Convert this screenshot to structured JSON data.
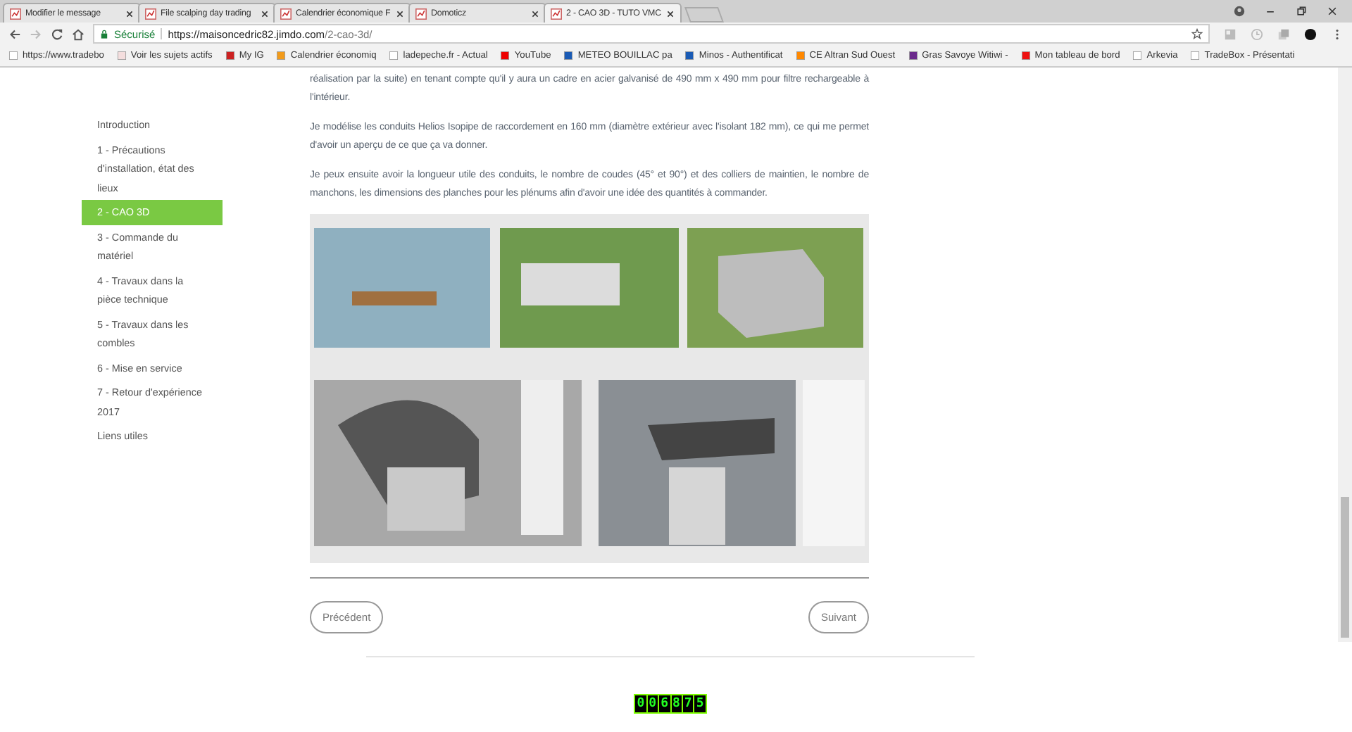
{
  "tabs": [
    {
      "title": "Modifier le message",
      "selected": false
    },
    {
      "title": "File scalping day trading",
      "selected": false
    },
    {
      "title": "Calendrier économique F",
      "selected": false
    },
    {
      "title": "Domoticz",
      "selected": false
    },
    {
      "title": "2 - CAO 3D - TUTO VMC",
      "selected": true
    }
  ],
  "address": {
    "secure_label": "Sécurisé",
    "host": "https://maisoncedric82.jimdo.com",
    "path": "/2-cao-3d/"
  },
  "bookmarks": [
    "https://www.tradebo",
    "Voir les sujets actifs",
    "My IG",
    "Calendrier économiq",
    "ladepeche.fr - Actual",
    "YouTube",
    "METEO BOUILLAC pa",
    "Minos - Authentificat",
    "CE Altran Sud Ouest",
    "Gras Savoye Witiwi -",
    "Mon tableau de bord",
    "Arkevia",
    "TradeBox - Présentati"
  ],
  "sidebar": {
    "items": [
      {
        "label": "Introduction",
        "selected": false
      },
      {
        "label": "1 - Précautions d'installation, état des lieux",
        "selected": false
      },
      {
        "label": "2 - CAO 3D",
        "selected": true
      },
      {
        "label": "3 - Commande du matériel",
        "selected": false
      },
      {
        "label": "4 - Travaux dans la pièce technique",
        "selected": false
      },
      {
        "label": "5 - Travaux dans les combles",
        "selected": false
      },
      {
        "label": "6 - Mise en service",
        "selected": false
      },
      {
        "label": "7 - Retour d'expérience 2017",
        "selected": false
      },
      {
        "label": "Liens utiles",
        "selected": false
      }
    ]
  },
  "paragraphs": [
    "réalisation par la suite) en tenant compte qu'il y aura un cadre en acier galvanisé de 490 mm x 490 mm pour filtre rechargeable à l'intérieur.",
    "Je modélise les conduits Helios Isopipe de raccordement en 160 mm (diamètre extérieur avec l'isolant 182 mm), ce qui me permet d'avoir un aperçu de ce que ça va donner.",
    "Je peux ensuite avoir la longueur utile des conduits, le nombre de coudes (45° et 90°) et des colliers de maintien, le nombre de manchons, les dimensions des planches pour les plénums afin d'avoir une idée des quantités à commander."
  ],
  "pager": {
    "previous": "Précédent",
    "next": "Suivant"
  },
  "counter": [
    "0",
    "0",
    "6",
    "8",
    "7",
    "5"
  ]
}
